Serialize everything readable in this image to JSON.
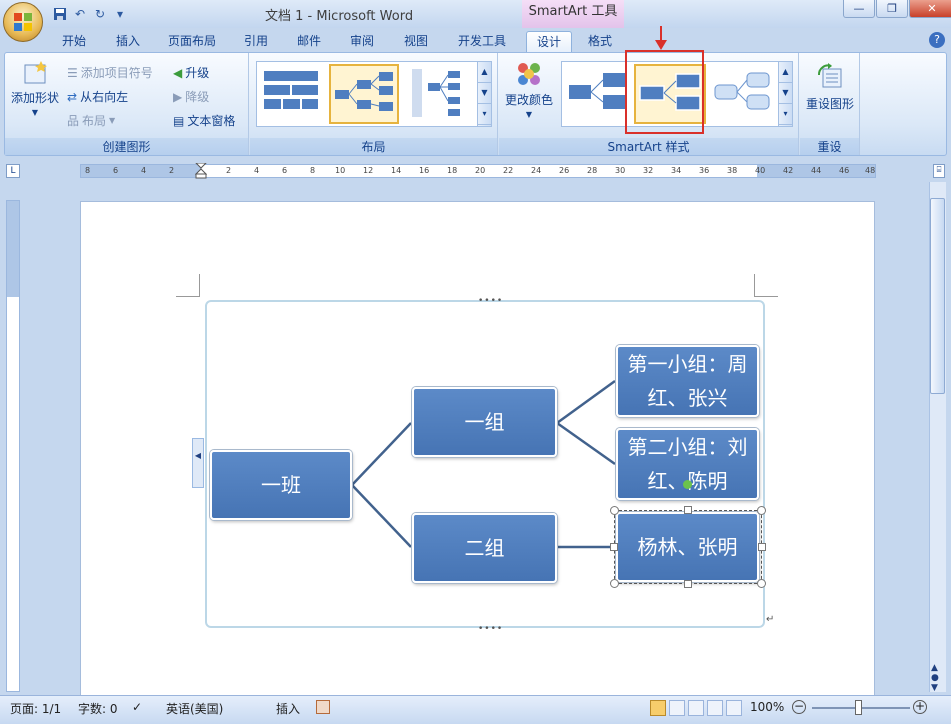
{
  "window": {
    "doc_title": "文档 1 - Microsoft Word",
    "context_tab": "SmartArt 工具"
  },
  "tabs": [
    "开始",
    "插入",
    "页面布局",
    "引用",
    "邮件",
    "审阅",
    "视图",
    "开发工具",
    "设计",
    "格式"
  ],
  "active_tab": "设计",
  "ribbon": {
    "create_graphic": {
      "label": "创建图形",
      "add_shape": "添加形状",
      "add_bullet": "添加项目符号",
      "right_to_left": "从右向左",
      "layout": "布局",
      "promote": "升级",
      "demote": "降级",
      "text_pane": "文本窗格"
    },
    "layouts": {
      "label": "布局"
    },
    "styles": {
      "label": "SmartArt 样式",
      "change_colors": "更改颜色"
    },
    "reset": {
      "label": "重设",
      "reset_graphic": "重设图形"
    }
  },
  "ruler": {
    "h_left": [
      "8",
      "6",
      "4",
      "2"
    ],
    "h_right": [
      "2",
      "4",
      "6",
      "8",
      "10",
      "12",
      "14",
      "16",
      "18",
      "20",
      "22",
      "24",
      "26",
      "28",
      "30",
      "32",
      "34",
      "36",
      "38",
      "40",
      "42",
      "44",
      "46",
      "48"
    ]
  },
  "smartart": {
    "root": "一班",
    "level1": [
      "一组",
      "二组"
    ],
    "leaf1": "第一小组：周红、张兴",
    "leaf2": "第二小组：刘红、陈明",
    "leaf3": "杨林、张明"
  },
  "status": {
    "page": "页面: 1/1",
    "words": "字数: 0",
    "language": "英语(美国)",
    "insert": "插入",
    "zoom": "100%"
  },
  "colors": {
    "node": "#4f7ec0",
    "accent_red": "#d9302a",
    "selection": "#e6b33e"
  }
}
